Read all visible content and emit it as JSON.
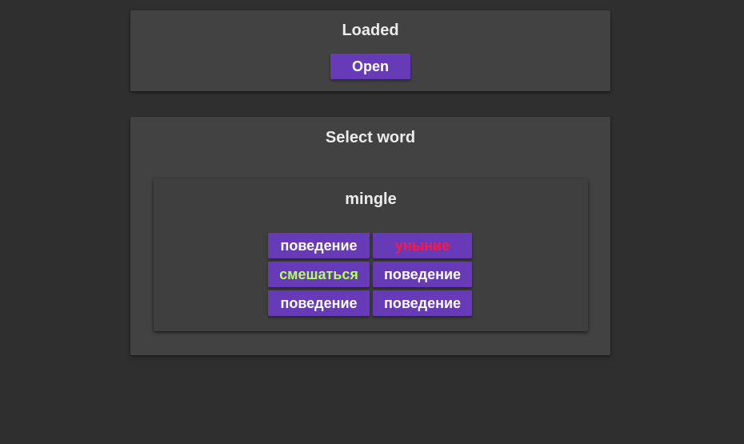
{
  "loaded_card": {
    "title": "Loaded",
    "open_label": "Open"
  },
  "select_card": {
    "title": "Select word",
    "word": "mingle",
    "options": [
      {
        "label": "поведение",
        "state": "neutral",
        "color": "#ffffff"
      },
      {
        "label": "уныние",
        "state": "wrong",
        "color": "#ff1744"
      },
      {
        "label": "смешаться",
        "state": "correct",
        "color": "#b2ff59"
      },
      {
        "label": "поведение",
        "state": "neutral",
        "color": "#ffffff"
      },
      {
        "label": "поведение",
        "state": "neutral",
        "color": "#ffffff"
      },
      {
        "label": "поведение",
        "state": "neutral",
        "color": "#ffffff"
      }
    ]
  },
  "colors": {
    "background": "#2f2f2f",
    "card": "#424242",
    "accent": "#673ab7",
    "wrong": "#ff1744",
    "correct": "#b2ff59"
  }
}
